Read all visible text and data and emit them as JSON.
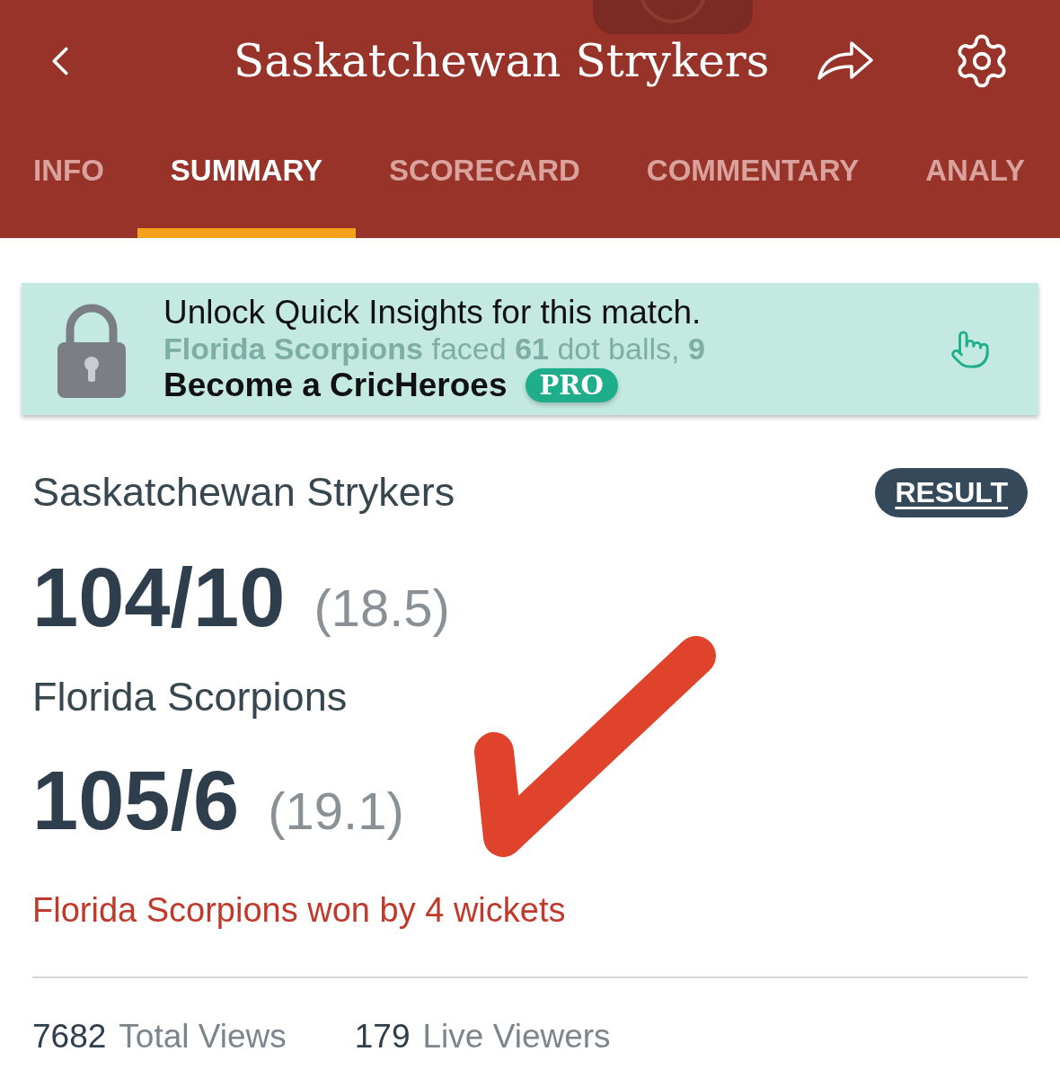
{
  "header": {
    "title": "Saskatchewan Strykers"
  },
  "tabs": [
    {
      "label": "INFO",
      "selected": false
    },
    {
      "label": "SUMMARY",
      "selected": true
    },
    {
      "label": "SCORECARD",
      "selected": false
    },
    {
      "label": "COMMENTARY",
      "selected": false
    },
    {
      "label": "ANALY",
      "selected": false
    }
  ],
  "banner": {
    "line_1": "Unlock Quick Insights for this match.",
    "line_2": "Become a CricHeroes",
    "badge": "PRO",
    "background_text": "**Florida Scorpions** faced **61** dot balls, **9**"
  },
  "status_badge": "RESULT",
  "innings": [
    {
      "team": "Saskatchewan Strykers",
      "score": "104/10",
      "overs": "(18.5)"
    },
    {
      "team": "Florida Scorpions",
      "score": "105/6",
      "overs": "(19.1)"
    }
  ],
  "result": "Florida Scorpions won by 4 wickets",
  "stats": [
    {
      "value": "7682",
      "label": "Total Views"
    },
    {
      "value": "179",
      "label": "Live Viewers"
    }
  ]
}
